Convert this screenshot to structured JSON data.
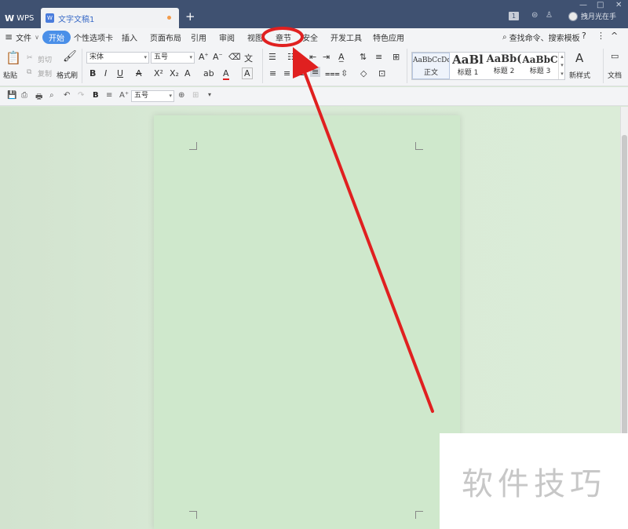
{
  "titlebar": {
    "app_label": "WPS",
    "doc_tab_label": "文字文稿1",
    "add_tab_symbol": "+",
    "badge": "1",
    "user_name": "拽月光在手",
    "minimize": "—",
    "maximize": "□",
    "close": "✕"
  },
  "menubar": {
    "file_label": "文件",
    "tabs": [
      {
        "label": "开始",
        "active": true
      },
      {
        "label": "个性选项卡"
      },
      {
        "label": "插入"
      },
      {
        "label": "页面布局"
      },
      {
        "label": "引用"
      },
      {
        "label": "审阅"
      },
      {
        "label": "视图"
      },
      {
        "label": "章节"
      },
      {
        "label": "安全"
      },
      {
        "label": "开发工具"
      },
      {
        "label": "特色应用"
      }
    ],
    "search_label": "查找命令、搜索模板",
    "help": "?",
    "more": "⋮",
    "collapse": "^"
  },
  "ribbon": {
    "paste": "粘贴",
    "cut": "剪切",
    "copy": "复制",
    "format_painter": "格式刷",
    "font_name": "宋体",
    "font_size": "五号",
    "styles": [
      {
        "preview": "AaBbCcDd",
        "label": "正文"
      },
      {
        "preview": "AaBl",
        "label": "标题 1"
      },
      {
        "preview": "AaBb(",
        "label": "标题 2"
      },
      {
        "preview": "AaBbC",
        "label": "标题 3"
      }
    ],
    "new_style": "新样式",
    "text_tools": "文档"
  },
  "quickbar": {
    "font_size": "五号"
  },
  "watermark": {
    "text": "软件技巧"
  },
  "colors": {
    "titlebar": "#3f5171",
    "active_tab": "#4a8fe8",
    "annotation": "#e02020",
    "page": "#cfe8cc"
  }
}
